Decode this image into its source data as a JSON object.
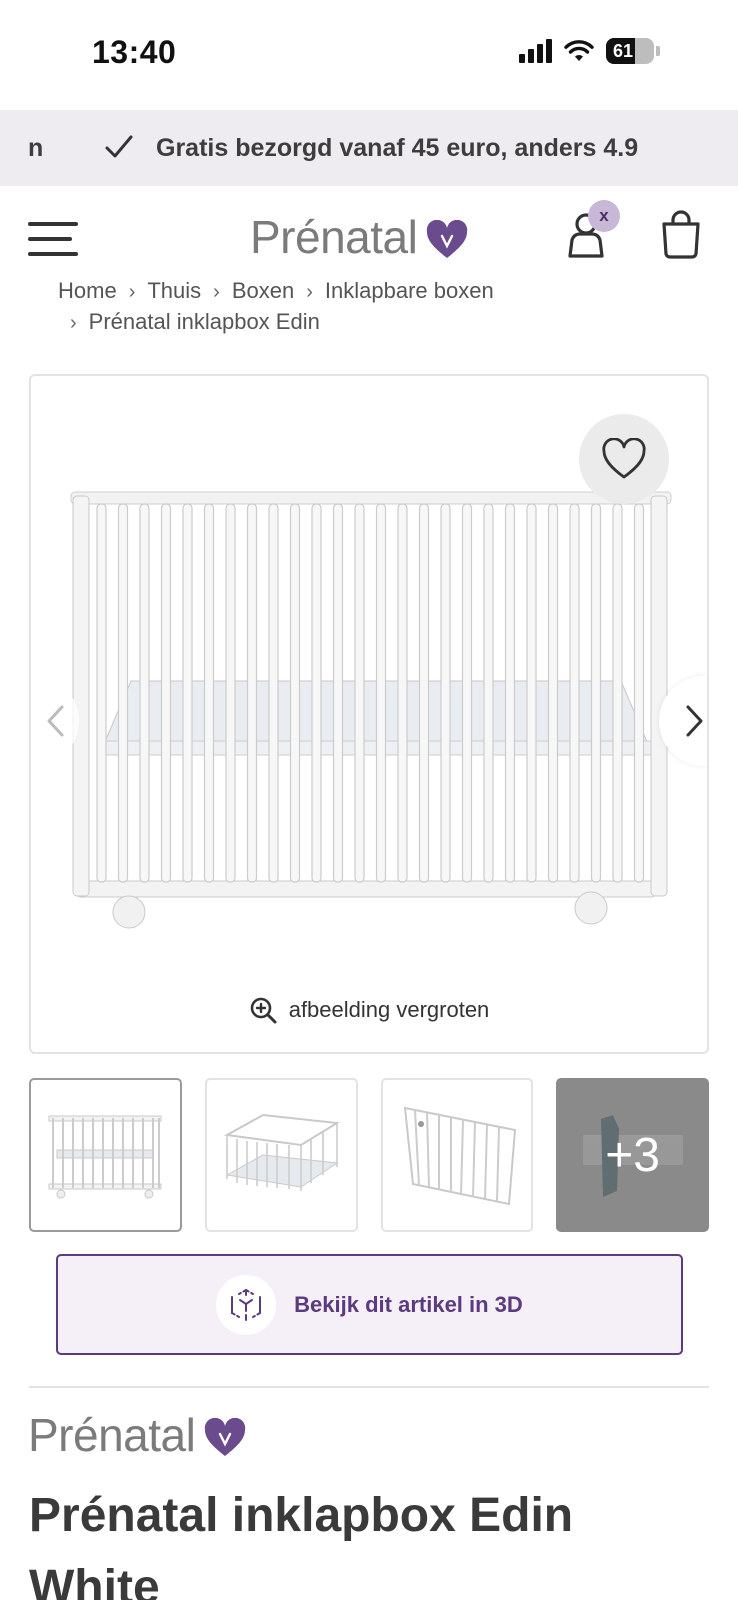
{
  "status_bar": {
    "time": "13:40",
    "battery": "61",
    "battery_level": 0.61
  },
  "promo": {
    "prev_fragment": "n",
    "text": "Gratis bezorgd vanaf 45 euro, anders 4.9"
  },
  "header": {
    "logo_text": "Prénatal",
    "account_badge": "x"
  },
  "breadcrumb": {
    "items": [
      "Home",
      "Thuis",
      "Boxen",
      "Inklapbare boxen",
      "Prénatal inklapbox Edin"
    ],
    "separator": "›"
  },
  "gallery": {
    "zoom_label": "afbeelding vergroten",
    "thumbnails": [
      {
        "alt": "inklapbox front"
      },
      {
        "alt": "inklapbox angled"
      },
      {
        "alt": "inklapbox folded"
      }
    ],
    "more_label": "+3"
  },
  "view_3d": {
    "label": "Bekijk dit artikel in 3D"
  },
  "product": {
    "brand": "Prénatal",
    "title": "Prénatal inklapbox Edin White"
  },
  "colors": {
    "brand_purple": "#5c3a7e",
    "heart_purple": "#6b4a8e",
    "promo_bg": "#eeecf1"
  },
  "icons": [
    "menu-icon",
    "heart-logo-icon",
    "account-icon",
    "cart-icon",
    "check-icon",
    "favorite-heart-icon",
    "chevron-left-icon",
    "chevron-right-icon",
    "zoom-in-icon",
    "cube-3d-icon"
  ]
}
